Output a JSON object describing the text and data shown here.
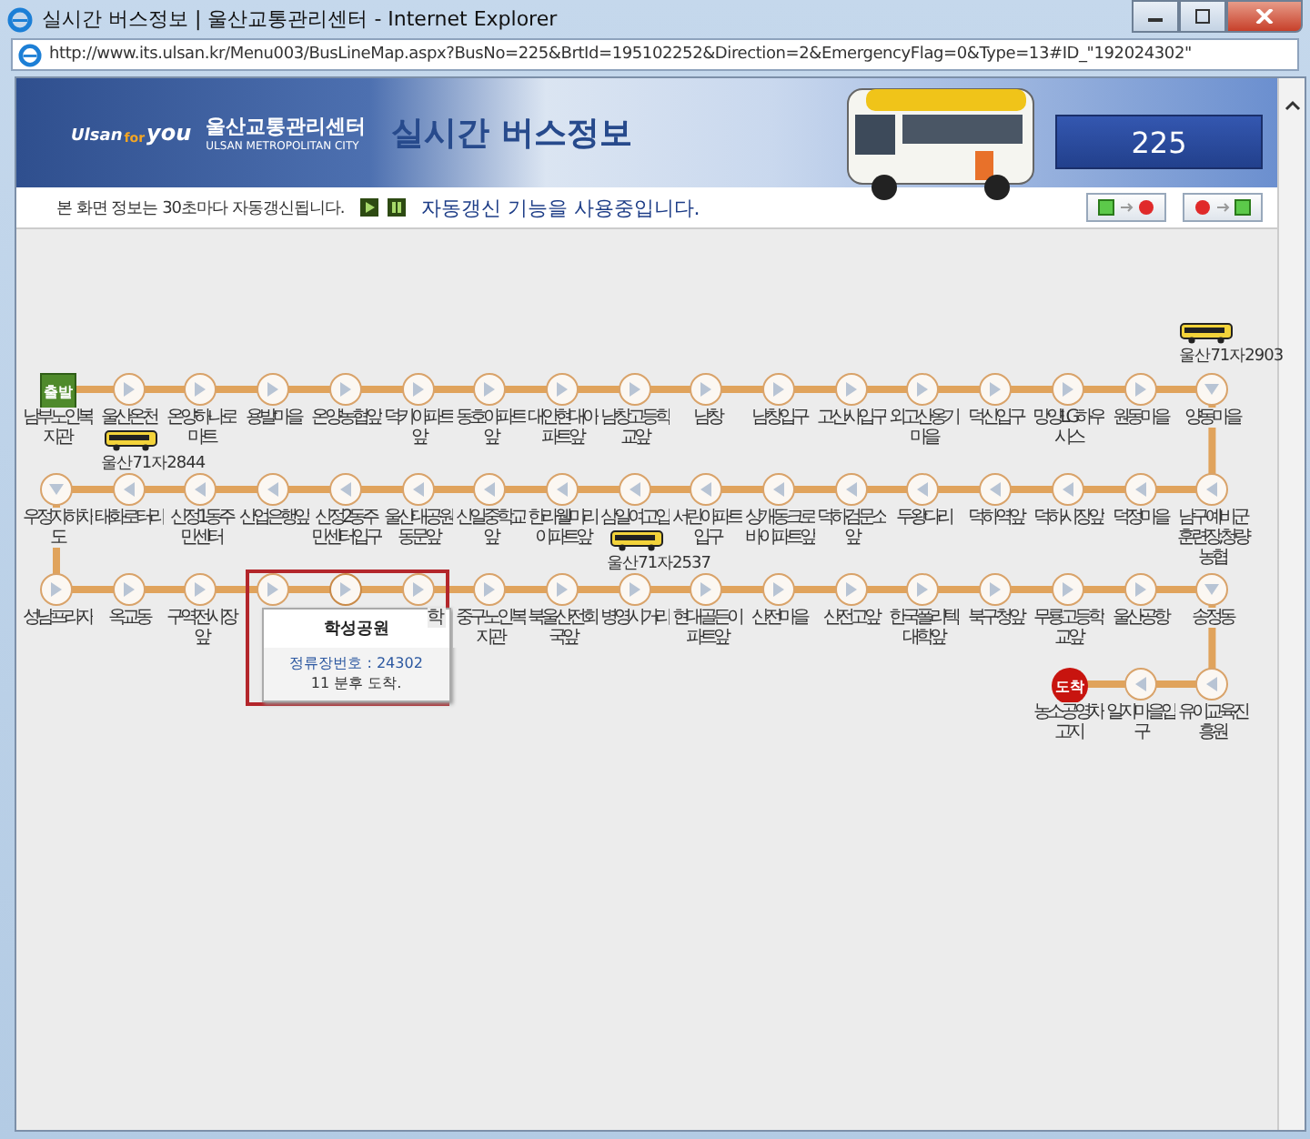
{
  "window": {
    "title": "실시간 버스정보 | 울산교통관리센터 - Internet Explorer"
  },
  "address_bar": {
    "url": "http://www.its.ulsan.kr/Menu003/BusLineMap.aspx?BusNo=225&BrtId=195102252&Direction=2&EmergencyFlag=0&Type=13#ID_\"192024302\""
  },
  "header": {
    "logo_words": [
      "Ulsan",
      "for",
      "you"
    ],
    "org_name": "울산교통관리센터",
    "org_subtitle": "ULSAN METROPOLITAN CITY",
    "title": "실시간 버스정보",
    "route_number": "225"
  },
  "info_bar": {
    "notice": "본 화면 정보는 30초마다 자동갱신됩니다.",
    "status": "자동갱신 기능을 사용중입니다."
  },
  "route_rows": [
    {
      "stops": [
        {
          "kind": "start",
          "badge": "출발",
          "label": "남부노인복지관",
          "selected": false
        },
        {
          "kind": "stop",
          "label": "울산온천",
          "selected": false,
          "bus": {
            "plate": "울산71자2844"
          }
        },
        {
          "kind": "stop",
          "label": "온양하나로마트",
          "selected": false
        },
        {
          "kind": "stop",
          "label": "용발마을",
          "selected": false
        },
        {
          "kind": "stop",
          "label": "온양농협앞",
          "selected": false
        },
        {
          "kind": "stop",
          "label": "덕키아파트앞",
          "selected": false
        },
        {
          "kind": "stop",
          "label": "동호아파트앞",
          "selected": false
        },
        {
          "kind": "stop",
          "label": "대안현대아파트앞",
          "selected": false
        },
        {
          "kind": "stop",
          "label": "남창고등학교앞",
          "selected": false
        },
        {
          "kind": "stop",
          "label": "남창",
          "selected": false
        },
        {
          "kind": "stop",
          "label": "남창입구",
          "selected": false
        },
        {
          "kind": "stop",
          "label": "고산사입구",
          "selected": false
        },
        {
          "kind": "stop",
          "label": "외고산옹기마을",
          "selected": false
        },
        {
          "kind": "stop",
          "label": "덕신입구",
          "selected": false
        },
        {
          "kind": "stop",
          "label": "망양LG하우시스",
          "selected": false
        },
        {
          "kind": "stop",
          "label": "원동마을",
          "selected": false
        },
        {
          "kind": "stop",
          "label": "양동마을",
          "selected": false,
          "bus": {
            "plate": "울산71자2903"
          }
        }
      ]
    },
    {
      "stops": [
        {
          "kind": "stop",
          "label": "우정지하차도",
          "selected": false
        },
        {
          "kind": "stop",
          "label": "태화로터리",
          "selected": false
        },
        {
          "kind": "stop",
          "label": "신정1동주민센터",
          "selected": false
        },
        {
          "kind": "stop",
          "label": "산업은행앞",
          "selected": false
        },
        {
          "kind": "stop",
          "label": "신정2동주민센터입구",
          "selected": false
        },
        {
          "kind": "stop",
          "label": "울산대공원동문앞",
          "selected": false
        },
        {
          "kind": "stop",
          "label": "신일중학교앞",
          "selected": false
        },
        {
          "kind": "stop",
          "label": "한라웰미리이파트앞",
          "selected": false
        },
        {
          "kind": "stop",
          "label": "삼일여고입",
          "selected": false,
          "bus": {
            "plate": "울산71자2537"
          }
        },
        {
          "kind": "stop",
          "label": "서린아파트입구",
          "selected": false
        },
        {
          "kind": "stop",
          "label": "상개동크로바이파트앞",
          "selected": false
        },
        {
          "kind": "stop",
          "label": "덕하검문소앞",
          "selected": false
        },
        {
          "kind": "stop",
          "label": "두왕다리",
          "selected": false
        },
        {
          "kind": "stop",
          "label": "덕하역앞",
          "selected": false
        },
        {
          "kind": "stop",
          "label": "덕하시장앞",
          "selected": false
        },
        {
          "kind": "stop",
          "label": "덕정마을",
          "selected": false
        },
        {
          "kind": "stop",
          "label": "남구예비군훈련장,청량농협",
          "selected": false
        }
      ]
    },
    {
      "stops": [
        {
          "kind": "stop",
          "label": "성남프라자",
          "selected": false
        },
        {
          "kind": "stop",
          "label": "옥교동",
          "selected": false
        },
        {
          "kind": "stop",
          "label": "구역전시장앞",
          "selected": false
        },
        {
          "kind": "stop",
          "selected": false
        },
        {
          "kind": "stop",
          "selected": true,
          "popup": {
            "name": "학성공원",
            "stop_number": "정류장번호 : 24302",
            "arrival": "11 분후 도착."
          }
        },
        {
          "kind": "stop",
          "label": "학",
          "label_cut": true,
          "selected": false
        },
        {
          "kind": "stop",
          "label": "중구노인복지관",
          "selected": false
        },
        {
          "kind": "stop",
          "label": "북울산전회국앞",
          "selected": false
        },
        {
          "kind": "stop",
          "label": "병영시거리",
          "selected": false
        },
        {
          "kind": "stop",
          "label": "현대골든이파트앞",
          "selected": false
        },
        {
          "kind": "stop",
          "label": "산전마을",
          "selected": false
        },
        {
          "kind": "stop",
          "label": "산전고앞",
          "selected": false
        },
        {
          "kind": "stop",
          "label": "한국폴리텍대학앞",
          "selected": false
        },
        {
          "kind": "stop",
          "label": "북구청앞",
          "selected": false
        },
        {
          "kind": "stop",
          "label": "무룡고등학교앞",
          "selected": false
        },
        {
          "kind": "stop",
          "label": "울산공항",
          "selected": false
        },
        {
          "kind": "stop",
          "label": "송정동",
          "selected": false
        }
      ]
    },
    {
      "stops": [
        {
          "kind": "end",
          "badge": "도착",
          "label": "농소공영차고지",
          "selected": false
        },
        {
          "kind": "stop",
          "label": "일지마을입구",
          "selected": false
        },
        {
          "kind": "stop",
          "label": "유이교육진흥원",
          "selected": false
        }
      ]
    }
  ]
}
